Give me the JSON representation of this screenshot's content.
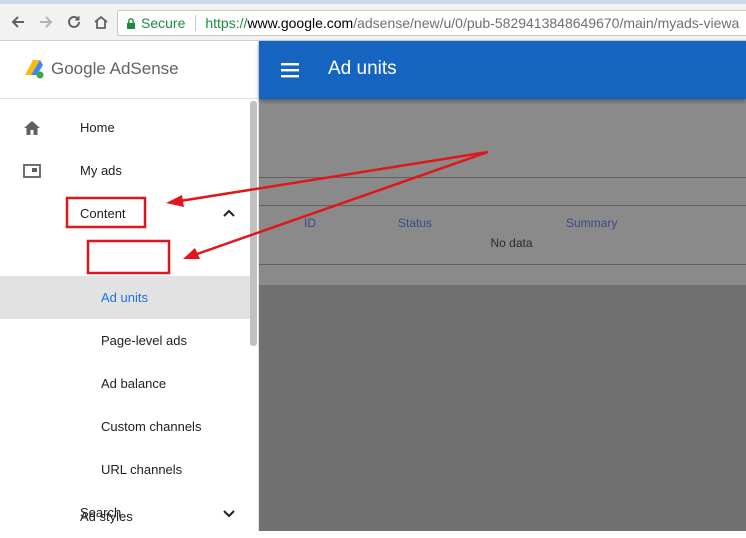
{
  "browser": {
    "secure_label": "Secure",
    "url_scheme": "https://",
    "url_host": "www.google.com",
    "url_path": "/adsense/new/u/0/pub-5829413848649670/main/myads-viewa",
    "icons": [
      "back-arrow-icon",
      "forward-arrow-icon",
      "reload-icon",
      "home-icon",
      "lock-icon"
    ]
  },
  "app": {
    "logo_text": "Google AdSense",
    "page_title": "Ad units",
    "accent_color": "#1565c0"
  },
  "sidebar": {
    "items": [
      {
        "label": "Home",
        "icon": "home-icon"
      },
      {
        "label": "My ads",
        "icon": "ads-icon"
      },
      {
        "label": "Content",
        "expanded": true
      },
      {
        "label": "Ad units",
        "selected": true
      },
      {
        "label": "Page-level ads"
      },
      {
        "label": "Ad balance"
      },
      {
        "label": "Custom channels"
      },
      {
        "label": "URL channels"
      },
      {
        "label": "Search",
        "expanded": false
      },
      {
        "label": "Ad styles"
      }
    ]
  },
  "table": {
    "columns": [
      "ID",
      "Status",
      "Summary"
    ],
    "empty_text": "No data"
  },
  "annotations": {
    "highlight_color": "#e0161d"
  }
}
